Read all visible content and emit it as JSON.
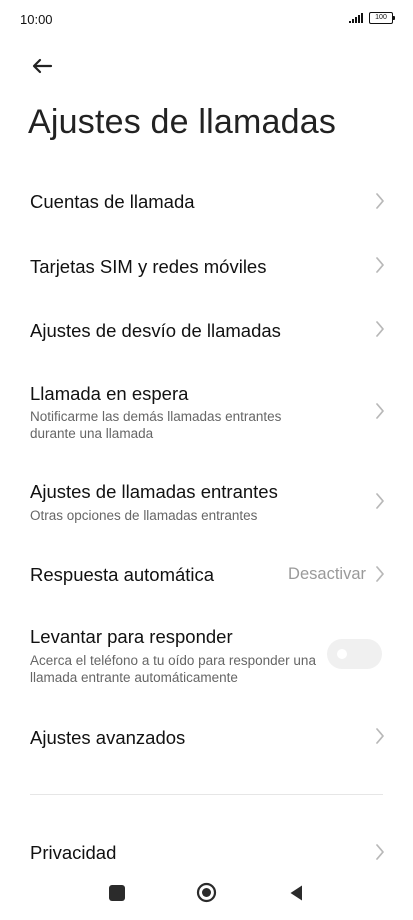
{
  "status_bar": {
    "time": "10:00",
    "battery": "100"
  },
  "header": {
    "title": "Ajustes de llamadas"
  },
  "settings": [
    {
      "id": "cuentas",
      "title": "Cuentas de llamada"
    },
    {
      "id": "sim",
      "title": "Tarjetas SIM y redes móviles"
    },
    {
      "id": "desvio",
      "title": "Ajustes de desvío de llamadas"
    },
    {
      "id": "espera",
      "title": "Llamada en espera",
      "subtitle": "Notificarme las demás llamadas entrantes durante una llamada"
    },
    {
      "id": "entrantes",
      "title": "Ajustes de llamadas entrantes",
      "subtitle": "Otras opciones de llamadas entrantes"
    },
    {
      "id": "respuesta",
      "title": "Respuesta automática",
      "value": "Desactivar"
    },
    {
      "id": "levantar",
      "title": "Levantar para responder",
      "subtitle": "Acerca el teléfono a tu oído para responder una llamada entrante automáticamente",
      "toggle": false
    },
    {
      "id": "avanzados",
      "title": "Ajustes avanzados"
    },
    {
      "id": "privacidad",
      "title": "Privacidad"
    }
  ],
  "icons": {
    "back": "arrow-left-icon",
    "chevron": "chevron-right-icon",
    "recents": "square-icon",
    "home": "circle-icon",
    "nav_back": "triangle-left-icon"
  },
  "colors": {
    "background": "#ffffff",
    "text": "#111111",
    "secondary_text": "#666666",
    "value_text": "#9a9a9a",
    "toggle_off": "#f0f0f0"
  }
}
